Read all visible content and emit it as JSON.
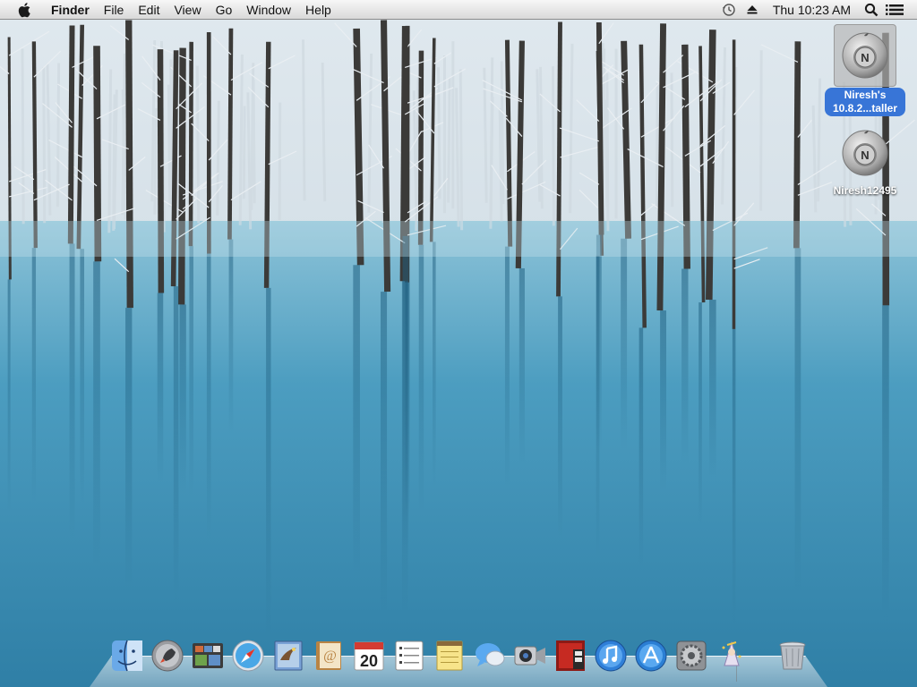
{
  "menubar": {
    "apple_icon": "apple-logo-icon",
    "items": [
      {
        "name": "finder",
        "label": "Finder"
      },
      {
        "name": "file",
        "label": "File"
      },
      {
        "name": "edit",
        "label": "Edit"
      },
      {
        "name": "view",
        "label": "View"
      },
      {
        "name": "go",
        "label": "Go"
      },
      {
        "name": "window",
        "label": "Window"
      },
      {
        "name": "help",
        "label": "Help"
      }
    ],
    "status": {
      "time_machine_icon": "time-machine-icon",
      "eject_icon": "eject-icon",
      "clock": "Thu 10:23 AM",
      "spotlight_icon": "spotlight-search-icon",
      "notification_icon": "notification-center-icon"
    }
  },
  "desktop": {
    "icons": [
      {
        "name": "installer-disk",
        "label": "Niresh's 10.8.2...taller",
        "selected": true,
        "icon": "niresh-disk-icon"
      },
      {
        "name": "niresh-drive",
        "label": "Niresh12495",
        "selected": false,
        "icon": "niresh-disk-icon"
      }
    ]
  },
  "dock": {
    "items": [
      {
        "name": "finder",
        "icon": "finder-icon"
      },
      {
        "name": "launchpad",
        "icon": "launchpad-icon"
      },
      {
        "name": "mission-control",
        "icon": "mission-control-icon"
      },
      {
        "name": "safari",
        "icon": "safari-icon"
      },
      {
        "name": "mail",
        "icon": "mail-icon"
      },
      {
        "name": "contacts",
        "icon": "contacts-icon"
      },
      {
        "name": "calendar",
        "icon": "calendar-icon",
        "label": "20"
      },
      {
        "name": "reminders",
        "icon": "reminders-icon"
      },
      {
        "name": "notes",
        "icon": "notes-icon"
      },
      {
        "name": "messages",
        "icon": "messages-icon"
      },
      {
        "name": "facetime",
        "icon": "facetime-icon"
      },
      {
        "name": "photo-booth",
        "icon": "photo-booth-icon"
      },
      {
        "name": "itunes",
        "icon": "itunes-icon"
      },
      {
        "name": "app-store",
        "icon": "app-store-icon"
      },
      {
        "name": "system-preferences",
        "icon": "system-preferences-icon"
      },
      {
        "name": "setup-assistant",
        "icon": "wizard-icon"
      },
      {
        "name": "trash",
        "icon": "trash-icon"
      }
    ]
  },
  "colors": {
    "menubar_bg": "#e8e8e8",
    "selection_blue": "#3875d7",
    "water_blue": "#3f8fb4",
    "snow_white": "#eef3f6"
  }
}
